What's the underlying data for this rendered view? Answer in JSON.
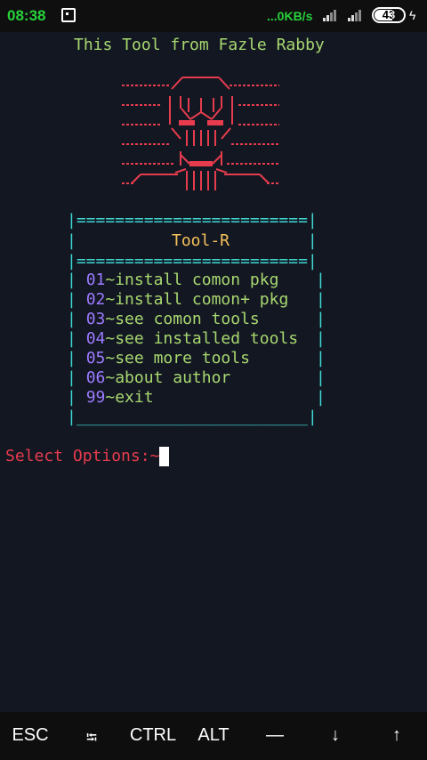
{
  "status": {
    "time": "08:38",
    "speed": "...0KB/s",
    "battery": "43"
  },
  "terminal": {
    "credit": "This Tool from Fazle Rabby",
    "box_title": "Tool-R",
    "menu": [
      {
        "num": "01",
        "label": "install comon pkg"
      },
      {
        "num": "02",
        "label": "install comon+ pkg"
      },
      {
        "num": "03",
        "label": "see comon tools"
      },
      {
        "num": "04",
        "label": "see installed tools"
      },
      {
        "num": "05",
        "label": "see more tools"
      },
      {
        "num": "06",
        "label": "about author"
      },
      {
        "num": "99",
        "label": "exit"
      }
    ],
    "separator": "~",
    "prompt": "Select Options:~"
  },
  "extra_keys": [
    "ESC",
    "⭾",
    "CTRL",
    "ALT",
    "—",
    "↓",
    "↑"
  ],
  "icons": [
    "notification-icon",
    "signal-icon",
    "battery-icon",
    "charging-icon"
  ]
}
